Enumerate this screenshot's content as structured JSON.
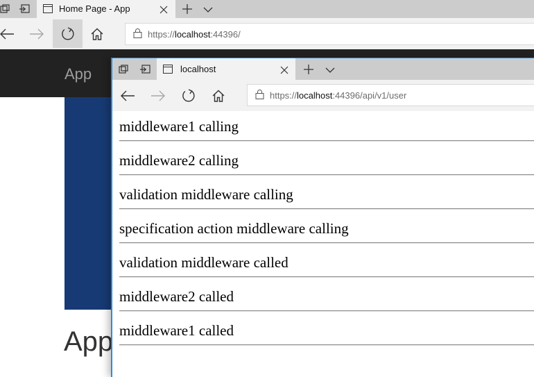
{
  "back_window": {
    "tab": {
      "title": "Home Page - App"
    },
    "address": {
      "scheme": "https://",
      "host": "localhost",
      "rest": ":44396/"
    },
    "navbar": {
      "brand": "App"
    },
    "heading": "App"
  },
  "front_window": {
    "tab": {
      "title": "localhost"
    },
    "address": {
      "scheme": "https://",
      "host": "localhost",
      "rest": ":44396/api/v1/user"
    },
    "lines": [
      "middleware1 calling",
      "middleware2 calling",
      "validation middleware calling",
      "specification action middleware calling",
      "validation middleware called",
      "middleware2 called",
      "middleware1 called"
    ]
  },
  "icons": [
    "tab-preview-icon",
    "set-aside-tabs-icon",
    "page-icon",
    "close-icon",
    "new-tab-icon",
    "chevron-down-icon",
    "back-arrow-icon",
    "forward-arrow-icon",
    "refresh-icon",
    "home-icon",
    "lock-icon"
  ],
  "colors": {
    "navbar": "#222222",
    "hero": "#173a74",
    "tabstrip": "#cccccc",
    "chrome": "#f2f2f2",
    "active_accent": "#2b8bd8"
  }
}
